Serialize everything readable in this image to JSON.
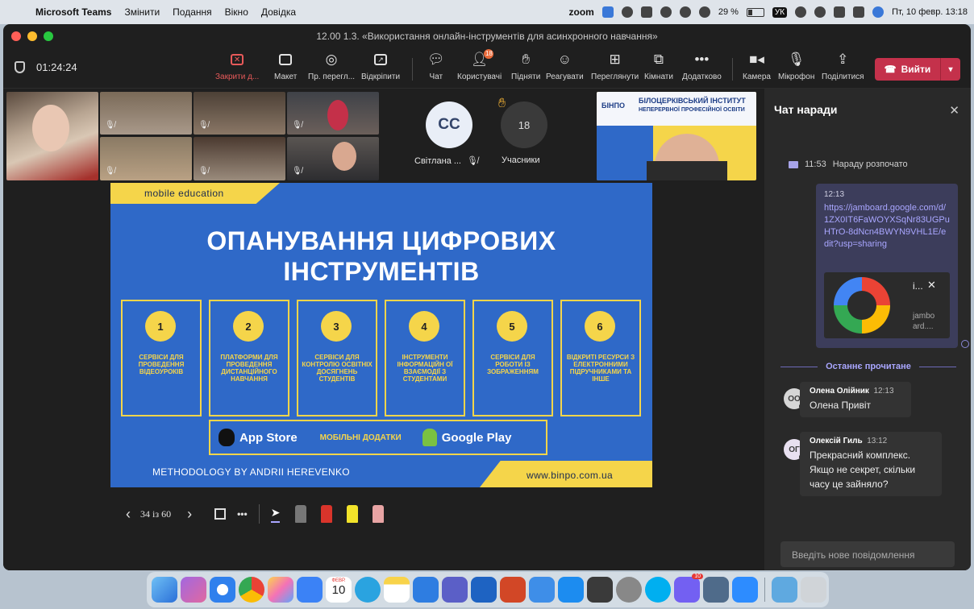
{
  "menubar": {
    "app_name": "Microsoft Teams",
    "menus": [
      "Змінити",
      "Подання",
      "Вікно",
      "Довідка"
    ],
    "zoom_label": "zoom",
    "battery_text": "29 %",
    "battery_level": 0.29,
    "keyboard_layout": "УК",
    "datetime": "Пт, 10 февр. 13:18"
  },
  "window": {
    "title": "12.00 1.3. «Використання онлайн-інструментів для асинхронного навчання»"
  },
  "toolbar": {
    "timer": "01:24:24",
    "buttons": [
      {
        "id": "stop-share",
        "label": "Закрити д...",
        "icon": "close-box-icon"
      },
      {
        "id": "layout",
        "label": "Макет",
        "icon": "layout-icon"
      },
      {
        "id": "presenter-view",
        "label": "Пр. перегл...",
        "icon": "eye-icon"
      },
      {
        "id": "pop-out",
        "label": "Відкріпити",
        "icon": "pop-out-icon"
      },
      {
        "id": "chat",
        "label": "Чат",
        "icon": "chat-icon"
      },
      {
        "id": "people",
        "label": "Користувачі",
        "icon": "people-icon",
        "badge": "18"
      },
      {
        "id": "raise-hand",
        "label": "Підняти",
        "icon": "hand-icon"
      },
      {
        "id": "react",
        "label": "Реагувати",
        "icon": "smile-icon"
      },
      {
        "id": "view",
        "label": "Переглянути",
        "icon": "grid-icon"
      },
      {
        "id": "rooms",
        "label": "Кімнати",
        "icon": "rooms-icon"
      },
      {
        "id": "more",
        "label": "Додатково",
        "icon": "more-icon"
      },
      {
        "id": "camera",
        "label": "Камера",
        "icon": "camera-icon"
      },
      {
        "id": "mic",
        "label": "Мікрофон",
        "icon": "mic-icon"
      },
      {
        "id": "share",
        "label": "Поділитися",
        "icon": "share-icon"
      }
    ],
    "leave_label": "Вийти"
  },
  "participants": {
    "cc_initials": "CC",
    "cc_name": "Світлана ...",
    "count": "18",
    "count_label": "Учасники"
  },
  "slide": {
    "tag": "mobile education",
    "headline_1": "ОПАНУВАННЯ ЦИФРОВИХ",
    "headline_2": "ІНСТРУМЕНТІВ",
    "cards": [
      {
        "num": "1",
        "text": "СЕРВІСИ ДЛЯ ПРОВЕДЕННЯ ВІДЕОУРОКІВ"
      },
      {
        "num": "2",
        "text": "ПЛАТФОРМИ ДЛЯ ПРОВЕДЕННЯ ДИСТАНЦІЙНОГО НАВЧАННЯ"
      },
      {
        "num": "3",
        "text": "СЕРВІСИ ДЛЯ КОНТРОЛЮ ОСВІТНІХ ДОСЯГНЕНЬ СТУДЕНТІВ"
      },
      {
        "num": "4",
        "text": "ІНСТРУМЕНТИ ІНФОРМАЦІЙН ОЇ ВЗАЄМОДІЇ З СТУДЕНТАМИ"
      },
      {
        "num": "5",
        "text": "СЕРВІСИ ДЛЯ РОБОТИ ІЗ ЗОБРАЖЕННЯМ"
      },
      {
        "num": "6",
        "text": "ВІДКРИТІ РЕСУРСИ З ЕЛЕКТРОННИМИ ПІДРУЧНИКАМИ ТА ІНШЕ"
      }
    ],
    "app_store": "App Store",
    "mobile_apps": "МОБІЛЬНІ ДОДАТКИ",
    "google_play": "Google Play",
    "footer_left": "METHODOLOGY BY ANDRII HEREVENKO",
    "footer_right": "www.binpo.com.ua"
  },
  "banner": {
    "logo": "БІНПО",
    "title_line1": "БІЛОЦЕРКІВСЬКИЙ ІНСТИТУТ",
    "title_line2": "НЕПЕРЕРВНОЇ ПРОФЕСІЙНОЇ ОСВІТИ"
  },
  "presenter": {
    "counter": "34 із 60"
  },
  "chat": {
    "title": "Чат наради",
    "meeting_started_time": "11:53",
    "meeting_started_text": "Нараду розпочато",
    "my_msg_time": "12:13",
    "my_msg_link": "https://jamboard.google.com/d/1ZX0IT6FaWOYXSqNr83UGPuHTrO-8dNcn4BWYN9VHL1E/edit?usp=sharing",
    "preview_title": "i...",
    "preview_domain": "jambo ard....",
    "last_read": "Останнє прочитане",
    "messages": [
      {
        "initials": "ОО",
        "name": "Олена Олійник",
        "time": "12:13",
        "text": "Олена Привіт",
        "status_color": "#92c353"
      },
      {
        "initials": "ОГ",
        "name": "Олексій Гиль",
        "time": "13:12",
        "text": "Прекрасний комплекс. Якщо не секрет, скільки часу це зайняло?",
        "status_color": "#c4314b"
      }
    ],
    "compose_placeholder": "Введіть нове повідомлення"
  },
  "dock": {
    "calendar_month": "ФЕВР.",
    "calendar_day": "10",
    "teams_badge": "10"
  },
  "colors": {
    "slide_blue": "#2f69c8",
    "slide_yellow": "#f5d54a",
    "leave_red": "#c4314b",
    "chat_accent": "#a9a6ff"
  }
}
